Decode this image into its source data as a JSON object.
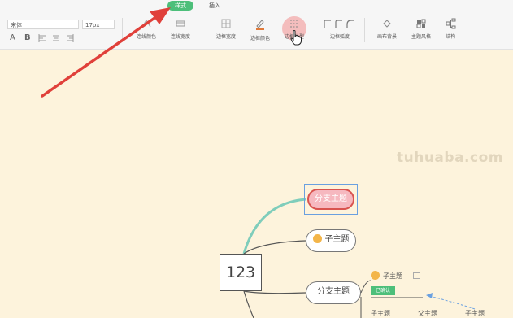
{
  "tabs": [
    {
      "label": "样式",
      "active": true
    },
    {
      "label": "插入",
      "active": false
    }
  ],
  "font": {
    "family_value": "宋体",
    "size_value": "17px",
    "more": "···"
  },
  "format_buttons": {
    "font_color": "A",
    "bold": "B"
  },
  "tools": [
    {
      "label": "连线颜色",
      "icon": "line-color-icon"
    },
    {
      "label": "连线宽度",
      "icon": "line-width-icon"
    },
    {
      "label": "边框宽度",
      "icon": "border-width-icon"
    },
    {
      "label": "边框颜色",
      "icon": "border-color-icon"
    },
    {
      "label": "边框类型",
      "icon": "border-type-icon"
    },
    {
      "label": "边框弧度",
      "icon": "border-radius-icon"
    },
    {
      "label": "画布背景",
      "icon": "canvas-background-icon"
    },
    {
      "label": "主题风格",
      "icon": "theme-style-icon"
    },
    {
      "label": "结构",
      "icon": "structure-icon"
    }
  ],
  "watermark": "tuhuaba.com",
  "mindmap": {
    "root": "123",
    "branch_selected": "分支主题",
    "sub_topic_1": "子主题",
    "branch_2": "分支主题",
    "sub_topic_2": "子主题",
    "confirmed_tag": "已确认",
    "bottom_sub_1": "子主题",
    "bottom_parent": "父主题",
    "bottom_sub_2": "子主题"
  },
  "colors": {
    "canvas": "#fdf3dc",
    "active_tab": "#4dbf7a",
    "selected_border": "#d9534f",
    "selected_fill": "#f6b8bf",
    "branch_line": "#7fcdbb",
    "arrow": "#e0403a"
  }
}
